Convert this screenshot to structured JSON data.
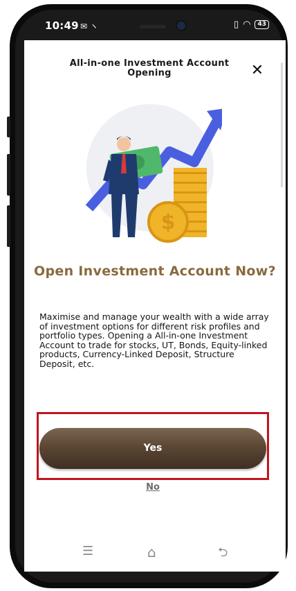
{
  "status_bar": {
    "time": "10:49",
    "battery": "43"
  },
  "header": {
    "title": "All-in-one Investment Account Opening",
    "close_icon": "close-icon"
  },
  "illustration": {
    "icon": "investment-growth-illustration",
    "colors": {
      "arrow": "#4a5fe0",
      "coins": "#f0b429",
      "money": "#4fb86a"
    }
  },
  "main": {
    "heading": "Open Investment Account Now?",
    "description": "Maximise and manage your wealth with a wide array of investment options for different risk profiles and portfolio types. Opening a All-in-one Investment Account to trade for stocks, UT, Bonds, Equity-linked products, Currency-Linked Deposit, Structure Deposit, etc."
  },
  "actions": {
    "yes_label": "Yes",
    "no_label": "No"
  },
  "colors": {
    "accent_heading": "#8a6a3f",
    "button_brown": "#5b4734",
    "highlight_red": "#c0151d"
  },
  "nav_bar": {
    "icons": [
      "menu-icon",
      "home-icon",
      "back-icon"
    ]
  }
}
